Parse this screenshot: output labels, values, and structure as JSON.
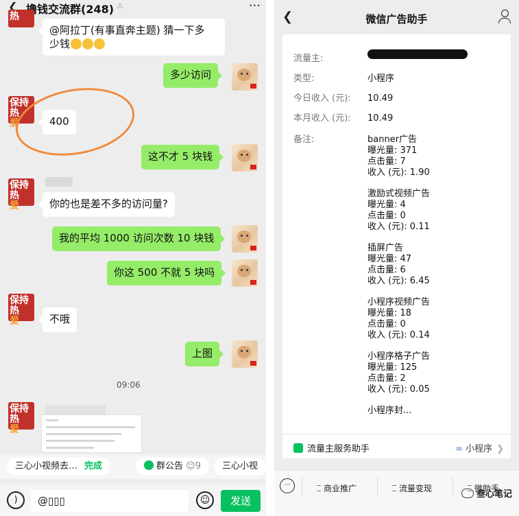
{
  "chat": {
    "back_icon": "chevron-left-icon",
    "title": "撸钱交流群(248)",
    "mute_icon": "bell-off-icon",
    "more_icon": "ellipsis-icon",
    "avatar_left": {
      "line1": "保持",
      "line2": "热",
      "line3": "爱"
    },
    "messages": {
      "m1_line1": "@阿拉丁(有事直奔主题) 猜一下多",
      "m1_line2": "少钱",
      "m2": "多少访问",
      "m3": "400",
      "m4": "这不才 5 块钱",
      "m5": "你的也是差不多的访问量?",
      "m6": "我的平均 1000 访问次数 10 块钱",
      "m7": "你这 500 不就 5 块吗",
      "m8": "不哦",
      "m9": "上图"
    },
    "timestamp": "09:06",
    "chips": {
      "c1_label": "三心小视频去…",
      "c1_action": "完成",
      "c2_label": "群公告",
      "c2_count": "9",
      "c3_label": "三心小视"
    },
    "input": {
      "value": "@▯▯▯",
      "send_label": "发送"
    }
  },
  "mp": {
    "title": "微信广告助手",
    "fields": {
      "owner_label": "流量主:",
      "type_label": "类型:",
      "type_value": "小程序",
      "today_label": "今日收入 (元):",
      "today_value": "10.49",
      "month_label": "本月收入 (元):",
      "month_value": "10.49",
      "remark_label": "备注:"
    },
    "ads": [
      {
        "name": "banner广告",
        "impressions": "曝光量: 371",
        "clicks": "点击量: 7",
        "income": "收入 (元): 1.90"
      },
      {
        "name": "激励式视频广告",
        "impressions": "曝光量: 4",
        "clicks": "点击量: 0",
        "income": "收入 (元): 0.11"
      },
      {
        "name": "插屏广告",
        "impressions": "曝光量: 47",
        "clicks": "点击量: 6",
        "income": "收入 (元): 6.45"
      },
      {
        "name": "小程序视频广告",
        "impressions": "曝光量: 18",
        "clicks": "点击量: 0",
        "income": "收入 (元): 0.14"
      },
      {
        "name": "小程序格子广告",
        "impressions": "曝光量: 125",
        "clicks": "点击量: 2",
        "income": "收入 (元): 0.05"
      }
    ],
    "more_text": "小程序封...",
    "helper": "流量主服务助手",
    "miniapp": "小程序",
    "menu": {
      "m1": "商业推广",
      "m2": "流量变现",
      "m3": "微助手"
    },
    "watermark": "叁心笔记"
  }
}
